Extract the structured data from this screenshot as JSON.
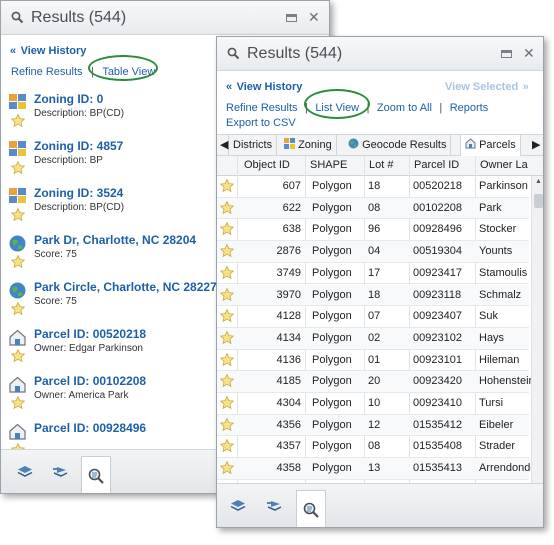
{
  "back_panel": {
    "title": "Results (544)",
    "view_history": "View History",
    "refine_results": "Refine Results",
    "table_view": "Table View",
    "items": [
      {
        "icon": "zoning-icon",
        "title": "Zoning ID: 0",
        "desc": "Description: BP(CD)"
      },
      {
        "icon": "zoning-icon",
        "title": "Zoning ID: 4857",
        "desc": "Description: BP"
      },
      {
        "icon": "zoning-icon",
        "title": "Zoning ID: 3524",
        "desc": "Description: BP(CD)"
      },
      {
        "icon": "globe-icon",
        "title": "Park Dr, Charlotte, NC 28204",
        "desc": "Score: 75"
      },
      {
        "icon": "globe-icon",
        "title": "Park Circle, Charlotte, NC 28227",
        "desc": "Score: 75"
      },
      {
        "icon": "parcel-house-icon",
        "title": "Parcel ID: 00520218",
        "desc": "Owner: Edgar Parkinson"
      },
      {
        "icon": "parcel-house-icon",
        "title": "Parcel ID: 00102208",
        "desc": "Owner: America Park"
      },
      {
        "icon": "parcel-house-icon",
        "title": "Parcel ID: 00928496",
        "desc": ""
      }
    ]
  },
  "front_panel": {
    "title": "Results (544)",
    "view_history": "View History",
    "view_selected": "View Selected",
    "refine_results": "Refine Results",
    "list_view": "List View",
    "zoom_to_all": "Zoom to All",
    "reports": "Reports",
    "export_csv": "Export to CSV",
    "tabs": [
      "Districts",
      "Zoning",
      "Geocode Results",
      "Parcels"
    ],
    "columns": [
      "Object ID",
      "SHAPE",
      "Lot #",
      "Parcel ID",
      "Owner La"
    ],
    "rows": [
      [
        "607",
        "Polygon",
        "18",
        "00520218",
        "Parkinson"
      ],
      [
        "622",
        "Polygon",
        "08",
        "00102208",
        "Park"
      ],
      [
        "638",
        "Polygon",
        "96",
        "00928496",
        "Stocker"
      ],
      [
        "2876",
        "Polygon",
        "04",
        "00519304",
        "Younts"
      ],
      [
        "3749",
        "Polygon",
        "17",
        "00923417",
        "Stamoulis"
      ],
      [
        "3970",
        "Polygon",
        "18",
        "00923118",
        "Schmalz"
      ],
      [
        "4128",
        "Polygon",
        "07",
        "00923407",
        "Suk"
      ],
      [
        "4134",
        "Polygon",
        "02",
        "00923102",
        "Hays"
      ],
      [
        "4136",
        "Polygon",
        "01",
        "00923101",
        "Hileman"
      ],
      [
        "4185",
        "Polygon",
        "20",
        "00923420",
        "Hohenstein"
      ],
      [
        "4304",
        "Polygon",
        "10",
        "00923410",
        "Tursi"
      ],
      [
        "4356",
        "Polygon",
        "12",
        "01535412",
        "Eibeler"
      ],
      [
        "4357",
        "Polygon",
        "08",
        "01535408",
        "Strader"
      ],
      [
        "4358",
        "Polygon",
        "13",
        "01535413",
        "Arrendondo"
      ]
    ]
  },
  "colors": {
    "link": "#1f5fa8",
    "highlight_ellipse": "#2e8b3a",
    "star": "#f4d03f"
  }
}
